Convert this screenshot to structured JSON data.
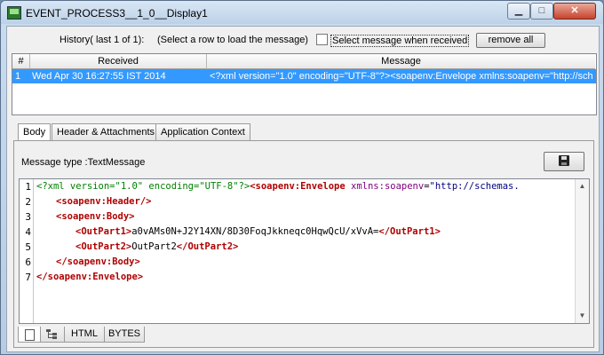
{
  "window": {
    "title": "EVENT_PROCESS3__1_0__Display1"
  },
  "history": {
    "label": "History( last 1 of 1):",
    "hint": "(Select a row to load the message)",
    "checkbox_label": "Select message when received",
    "remove_all_label": "remove all"
  },
  "table": {
    "columns": [
      "#",
      "Received",
      "Message"
    ],
    "rows": [
      {
        "num": "1",
        "received": "Wed Apr 30 16:27:55 IST 2014",
        "message": "<?xml version=\"1.0\" encoding=\"UTF-8\"?><soapenv:Envelope xmlns:soapenv=\"http://sch..."
      }
    ]
  },
  "tabs": [
    "Body",
    "Header & Attachments",
    "Application Context"
  ],
  "body": {
    "message_type": "Message type :TextMessage",
    "line_numbers": [
      "1",
      "2",
      "3",
      "4",
      "5",
      "6",
      "7"
    ],
    "code": {
      "l1_pi": "<?xml version=\"1.0\" encoding=\"UTF-8\"?>",
      "l1_tag": "<soapenv:Envelope ",
      "l1_attr": "xmlns:soapenv",
      "l1_eq": "=",
      "l1_val": "\"http://schemas.",
      "l2": "<soapenv:Header/>",
      "l3": "<soapenv:Body>",
      "l4_open": "<OutPart1>",
      "l4_text": "a0vAMs0N+J2Y14XN/8D30FoqJkkneqc0HqwQcU/xVvA=",
      "l4_close": "</OutPart1>",
      "l5_open": "<OutPart2>",
      "l5_text": "OutPart2",
      "l5_close": "</OutPart2>",
      "l6": "</soapenv:Body>",
      "l7": "</soapenv:Envelope>"
    }
  },
  "bottom_tabs": {
    "html": "HTML",
    "bytes": "BYTES"
  }
}
